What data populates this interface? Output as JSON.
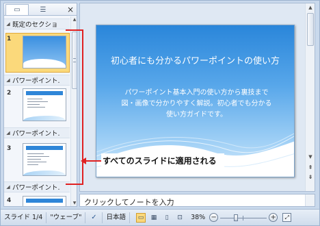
{
  "panel": {
    "tab_slides_icon": "slides-tab-icon",
    "tab_outline_icon": "outline-tab-icon",
    "close_label": "×"
  },
  "sections": [
    {
      "label": "既定のセクショ"
    },
    {
      "label": "パワーポイント."
    },
    {
      "label": "パワーポイント."
    },
    {
      "label": "パワーポイント."
    }
  ],
  "slide_numbers": [
    "1",
    "2",
    "3",
    "4"
  ],
  "slide": {
    "title": "初心者にも分かるパワーポイントの使い方",
    "body": "パワーポイント基本入門の使い方から裏技まで図・画像で分かりやすく解説。初心者でも分かる使い方ガイドです。"
  },
  "notes": {
    "placeholder": "クリックしてノートを入力"
  },
  "annotation": {
    "label": "すべてのスライドに適用される",
    "color": "#e02020"
  },
  "status": {
    "slide_counter": "スライド 1/4",
    "theme": "\"ウェーブ\"",
    "language": "日本語",
    "zoom": "38%",
    "zoom_out": "−",
    "zoom_in": "+"
  },
  "colors": {
    "selection": "#fbd97b",
    "slide_top": "#2a86da"
  }
}
